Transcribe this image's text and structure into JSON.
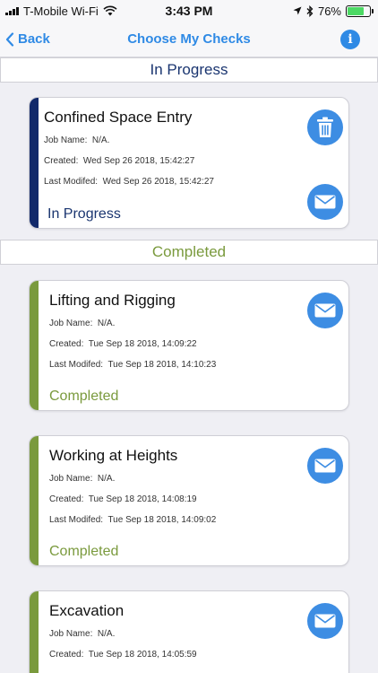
{
  "status_bar": {
    "carrier": "T-Mobile Wi-Fi",
    "time": "3:43 PM",
    "battery": "76%",
    "battery_level": 0.76,
    "battery_color": "#4cd964"
  },
  "nav": {
    "back_label": "Back",
    "title": "Choose My Checks",
    "info_icon": "i"
  },
  "sections": {
    "in_progress": "In Progress",
    "completed": "Completed"
  },
  "colors": {
    "accent": "#2f8ae5",
    "in_progress": "#11296a",
    "completed": "#7a9a3d"
  },
  "cards": [
    {
      "title": "Confined Space Entry",
      "job_label": "Job Name:",
      "job_value": "N/A.",
      "created_label": "Created:",
      "created_value": "Wed Sep 26 2018, 15:42:27",
      "modified_label": "Last Modifed:",
      "modified_value": "Wed Sep 26 2018, 15:42:27",
      "status": "In Progress"
    },
    {
      "title": "Lifting and Rigging",
      "job_label": "Job Name:",
      "job_value": "N/A.",
      "created_label": "Created:",
      "created_value": "Tue Sep 18 2018, 14:09:22",
      "modified_label": "Last Modifed:",
      "modified_value": "Tue Sep 18 2018, 14:10:23",
      "status": "Completed"
    },
    {
      "title": "Working at Heights",
      "job_label": "Job Name:",
      "job_value": "N/A.",
      "created_label": "Created:",
      "created_value": "Tue Sep 18 2018, 14:08:19",
      "modified_label": "Last Modifed:",
      "modified_value": "Tue Sep 18 2018, 14:09:02",
      "status": "Completed"
    },
    {
      "title": "Excavation",
      "job_label": "Job Name:",
      "job_value": "N/A.",
      "created_label": "Created:",
      "created_value": "Tue Sep 18 2018, 14:05:59"
    }
  ]
}
